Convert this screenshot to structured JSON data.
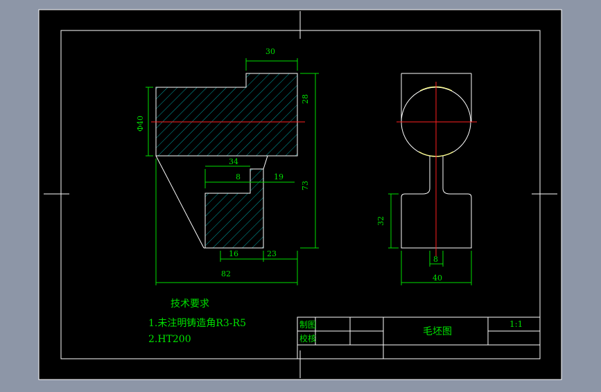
{
  "drawing": {
    "title": "毛坯图",
    "scale": "1:1"
  },
  "title_block": {
    "row1_label": "制图",
    "row2_label": "校核"
  },
  "notes": {
    "heading": "技术要求",
    "line1": "1.未注明铸造角R3-R5",
    "line2": "2.HT200"
  },
  "dimensions": {
    "d30": "30",
    "d28": "28",
    "d40dia": "Φ40",
    "d34": "34",
    "d8a": "8",
    "d19": "19",
    "d73": "73",
    "d16": "16",
    "d23": "23",
    "d82": "82",
    "d32": "32",
    "d8b": "8",
    "d40": "40"
  },
  "colors": {
    "background": "#8d96a7",
    "paper": "#000000",
    "line": "#ffffff",
    "dimension": "#00e000",
    "hatch": "#00cccc",
    "center": "#ff2020",
    "arc": "#ffff80"
  }
}
